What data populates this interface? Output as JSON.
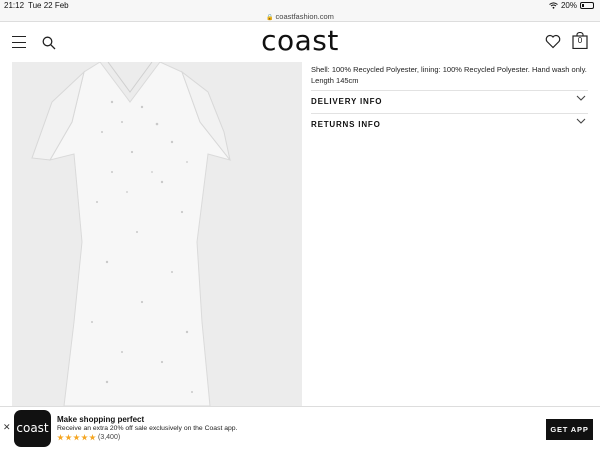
{
  "status_bar": {
    "time": "21:12",
    "date": "Tue 22 Feb",
    "battery": "20%",
    "battery_level": 0.2
  },
  "browser": {
    "url": "coastfashion.com"
  },
  "header": {
    "logo": "coast",
    "bag_count": "0"
  },
  "icons": [
    "menu-icon",
    "search-icon",
    "heart-icon",
    "bag-icon",
    "lock-icon",
    "wifi-icon",
    "battery-icon",
    "chevron-down-icon",
    "close-icon",
    "star-icon"
  ],
  "product": {
    "description": "Shell: 100% Recycled Polyester, lining: 100% Recycled Polyester. Hand wash only. Length 145cm",
    "accordions": [
      {
        "label": "DELIVERY INFO"
      },
      {
        "label": "RETURNS INFO"
      }
    ]
  },
  "app_banner": {
    "title": "Make shopping perfect",
    "subtitle": "Receive an extra 20% off sale exclusively on the Coast app.",
    "app_name": "coast",
    "rating_count": "(3,400)",
    "stars": 5,
    "cta": "GET APP"
  },
  "colors": {
    "accent": "#111111",
    "star": "#f5a623",
    "image_bg": "#ededed"
  }
}
